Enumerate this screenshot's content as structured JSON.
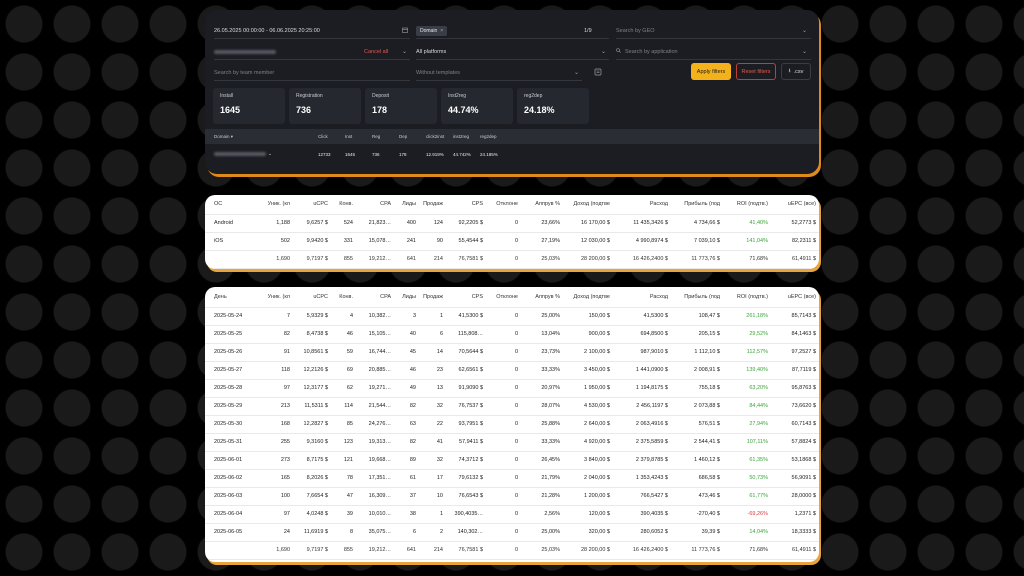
{
  "filters": {
    "date_range": "26.05.2025 00:00:00 - 06.06.2025 20:25:00",
    "domain_chip": "Domain",
    "domain_count": "1/9",
    "geo_placeholder": "Search by GEO",
    "cancel_label": "Cancel all",
    "platforms_value": "All platforms",
    "application_placeholder": "Search by application",
    "team_placeholder": "Search by team member",
    "templates_value": "Without templates",
    "apply_label": "Apply filters",
    "reset_label": "Reset filters",
    "csv_label": ".csv"
  },
  "stats": [
    {
      "label": "Install",
      "value": "1645"
    },
    {
      "label": "Registration",
      "value": "736"
    },
    {
      "label": "Deposit",
      "value": "178"
    },
    {
      "label": "Inst2reg",
      "value": "44.74%"
    },
    {
      "label": "reg2dep",
      "value": "24.18%"
    }
  ],
  "domain_table": {
    "headers": [
      "Domain",
      "Click",
      "Inst",
      "Reg",
      "Dep",
      "click2inst",
      "inst2reg",
      "reg2dep"
    ],
    "row": [
      "",
      "12733",
      "1645",
      "736",
      "178",
      "12.919%",
      "44.742%",
      "24.185%"
    ]
  },
  "os_table": {
    "headers": [
      "ОС",
      "Уник. (кл",
      "uCPC",
      "Конв.",
      "CPA",
      "Лиды",
      "Продаж",
      "CPS",
      "Отклоне",
      "Аппрув %",
      "Доход (подтве",
      "Расход",
      "Прибыль (под",
      "ROI (подтв.)",
      "uEPC (все)"
    ],
    "rows": [
      [
        "Android",
        "1,188",
        "9,6257 $",
        "524",
        "21,823…",
        "400",
        "124",
        "92,2205 $",
        "0",
        "23,66%",
        "16 170,00 $",
        "11 435,3426 $",
        "4 734,66 $",
        "41,40%",
        "52,2773 $"
      ],
      [
        "iOS",
        "502",
        "9,9420 $",
        "331",
        "15,078…",
        "241",
        "90",
        "55,4544 $",
        "0",
        "27,19%",
        "12 030,00 $",
        "4 990,8974 $",
        "7 039,10 $",
        "141,04%",
        "82,2311 $"
      ]
    ],
    "totals": [
      "",
      "1,690",
      "9,7197 $",
      "855",
      "19,212…",
      "641",
      "214",
      "76,7581 $",
      "0",
      "25,03%",
      "28 200,00 $",
      "16 426,2400 $",
      "11 773,76 $",
      "71,68%",
      "61,4911 $"
    ]
  },
  "day_table": {
    "headers": [
      "День",
      "Уник. (кл",
      "uCPC",
      "Конв.",
      "CPA",
      "Лиды",
      "Продаж",
      "CPS",
      "Отклоне",
      "Аппрув %",
      "Доход (подтве",
      "Расход",
      "Прибыль (под",
      "ROI (подтв.)",
      "uEPC (все)"
    ],
    "rows": [
      [
        "2025-05-24",
        "7",
        "5,9329 $",
        "4",
        "10,382…",
        "3",
        "1",
        "41,5300 $",
        "0",
        "25,00%",
        "150,00 $",
        "41,5300 $",
        "108,47 $",
        "261,18%",
        "85,7143 $"
      ],
      [
        "2025-05-25",
        "82",
        "8,4738 $",
        "46",
        "15,105…",
        "40",
        "6",
        "115,808…",
        "0",
        "13,04%",
        "900,00 $",
        "694,8500 $",
        "205,15 $",
        "29,52%",
        "84,1463 $"
      ],
      [
        "2025-05-26",
        "91",
        "10,8561 $",
        "59",
        "16,744…",
        "45",
        "14",
        "70,5644 $",
        "0",
        "23,73%",
        "2 100,00 $",
        "987,9010 $",
        "1 112,10 $",
        "112,57%",
        "97,2527 $"
      ],
      [
        "2025-05-27",
        "118",
        "12,2126 $",
        "69",
        "20,885…",
        "46",
        "23",
        "62,6561 $",
        "0",
        "33,33%",
        "3 450,00 $",
        "1 441,0900 $",
        "2 008,91 $",
        "139,40%",
        "87,7119 $"
      ],
      [
        "2025-05-28",
        "97",
        "12,3177 $",
        "62",
        "19,271…",
        "49",
        "13",
        "91,9090 $",
        "0",
        "20,97%",
        "1 950,00 $",
        "1 194,8175 $",
        "755,18 $",
        "63,20%",
        "95,8763 $"
      ],
      [
        "2025-05-29",
        "213",
        "11,5311 $",
        "114",
        "21,544…",
        "82",
        "32",
        "76,7537 $",
        "0",
        "28,07%",
        "4 530,00 $",
        "2 456,1197 $",
        "2 073,88 $",
        "84,44%",
        "73,6620 $"
      ],
      [
        "2025-05-30",
        "168",
        "12,2827 $",
        "85",
        "24,276…",
        "63",
        "22",
        "93,7951 $",
        "0",
        "25,88%",
        "2 640,00 $",
        "2 063,4916 $",
        "576,51 $",
        "27,94%",
        "60,7143 $"
      ],
      [
        "2025-05-31",
        "255",
        "9,3160 $",
        "123",
        "19,313…",
        "82",
        "41",
        "57,9411 $",
        "0",
        "33,33%",
        "4 920,00 $",
        "2 375,5859 $",
        "2 544,41 $",
        "107,11%",
        "57,8824 $"
      ],
      [
        "2025-06-01",
        "273",
        "8,7175 $",
        "121",
        "19,668…",
        "89",
        "32",
        "74,3712 $",
        "0",
        "26,45%",
        "3 840,00 $",
        "2 379,8785 $",
        "1 460,12 $",
        "61,35%",
        "53,1868 $"
      ],
      [
        "2025-06-02",
        "165",
        "8,2026 $",
        "78",
        "17,351…",
        "61",
        "17",
        "79,6132 $",
        "0",
        "21,79%",
        "2 040,00 $",
        "1 353,4243 $",
        "686,58 $",
        "50,73%",
        "56,9091 $"
      ],
      [
        "2025-06-03",
        "100",
        "7,6654 $",
        "47",
        "16,309…",
        "37",
        "10",
        "76,6543 $",
        "0",
        "21,28%",
        "1 200,00 $",
        "766,5427 $",
        "473,46 $",
        "61,77%",
        "28,0000 $"
      ],
      [
        "2025-06-04",
        "97",
        "4,0248 $",
        "39",
        "10,010…",
        "38",
        "1",
        "390,4035…",
        "0",
        "2,56%",
        "120,00 $",
        "390,4035 $",
        "-270,40 $",
        "-69,26%",
        "1,2371 $"
      ],
      [
        "2025-06-05",
        "24",
        "11,6919 $",
        "8",
        "35,075…",
        "6",
        "2",
        "140,302…",
        "0",
        "25,00%",
        "320,00 $",
        "280,6052 $",
        "39,39 $",
        "14,04%",
        "18,3333 $"
      ]
    ],
    "totals": [
      "",
      "1,690",
      "9,7197 $",
      "855",
      "19,212…",
      "641",
      "214",
      "76,7581 $",
      "0",
      "25,03%",
      "28 200,00 $",
      "16 426,2400 $",
      "11 773,76 $",
      "71,68%",
      "61,4911 $"
    ]
  }
}
